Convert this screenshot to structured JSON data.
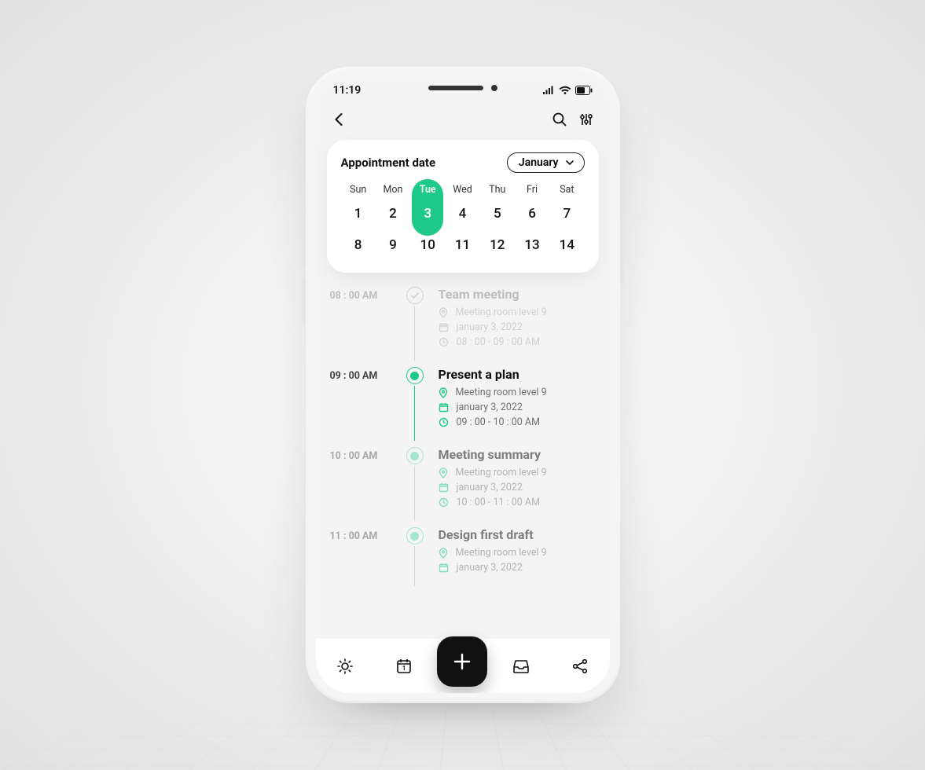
{
  "status": {
    "time": "11:19"
  },
  "header": {
    "card_title": "Appointment date",
    "month": "January"
  },
  "calendar": {
    "dow": [
      "Sun",
      "Mon",
      "Tue",
      "Wed",
      "Thu",
      "Fri",
      "Sat"
    ],
    "rows": [
      [
        "1",
        "2",
        "3",
        "4",
        "5",
        "6",
        "7"
      ],
      [
        "8",
        "9",
        "10",
        "11",
        "12",
        "13",
        "14"
      ]
    ],
    "selected_index": 2
  },
  "events": [
    {
      "time": "08 : 00 AM",
      "title": "Team meeting",
      "location": "Meeting room level 9",
      "date": "january 3, 2022",
      "range": "08 : 00 - 09 : 00 AM",
      "state": "done"
    },
    {
      "time": "09 : 00 AM",
      "title": "Present a plan",
      "location": "Meeting room level 9",
      "date": "january 3, 2022",
      "range": "09 : 00 - 10 : 00 AM",
      "state": "current"
    },
    {
      "time": "10 : 00 AM",
      "title": "Meeting summary",
      "location": "Meeting room level 9",
      "date": "january 3, 2022",
      "range": "10 : 00 - 11 : 00 AM",
      "state": "upcoming"
    },
    {
      "time": "11 : 00 AM",
      "title": "Design first draft",
      "location": "Meeting room level 9",
      "date": "january 3, 2022",
      "range": "",
      "state": "upcoming"
    }
  ],
  "colors": {
    "accent": "#1ec887"
  }
}
